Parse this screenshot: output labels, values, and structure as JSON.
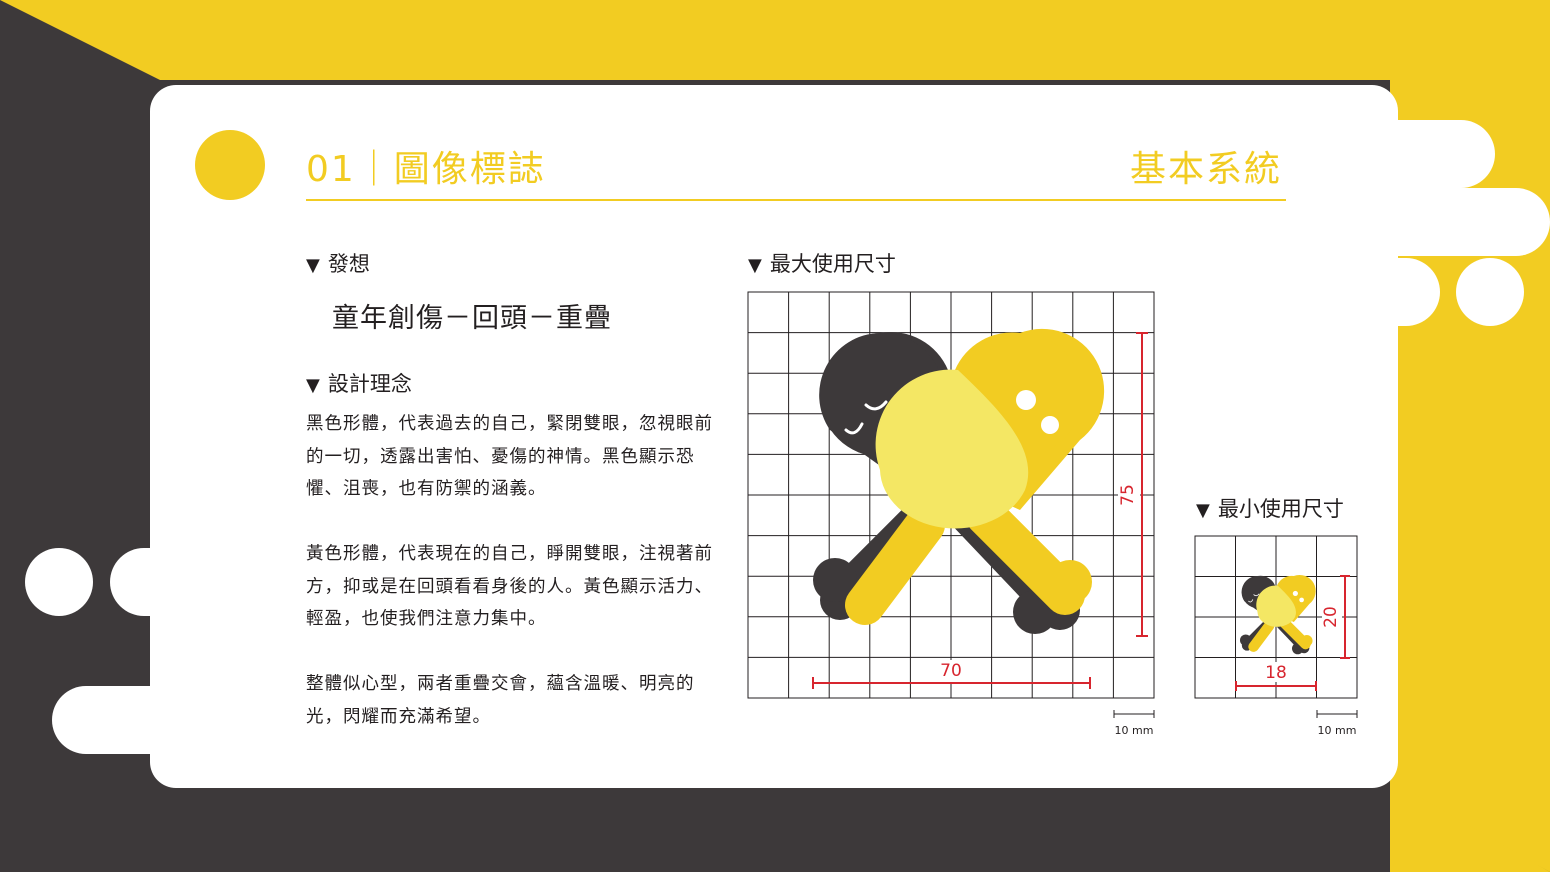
{
  "header": {
    "section_title": "01｜圖像標誌",
    "category": "基本系統"
  },
  "idea": {
    "heading": "發想",
    "concept": "童年創傷－回頭－重疊"
  },
  "design": {
    "heading": "設計理念",
    "paragraphs": [
      "黑色形體，代表過去的自己，緊閉雙眼，忽視眼前的一切，透露出害怕、憂傷的神情。黑色顯示恐懼、沮喪，也有防禦的涵義。",
      "黃色形體，代表現在的自己，睜開雙眼，注視著前方，抑或是在回頭看看身後的人。黃色顯示活力、輕盈，也使我們注意力集中。",
      "整體似心型，兩者重疊交會，蘊含溫暖、明亮的光，閃耀而充滿希望。"
    ]
  },
  "max_size": {
    "heading": "最大使用尺寸",
    "width_mm": "70",
    "height_mm": "75",
    "scale": "10 mm"
  },
  "min_size": {
    "heading": "最小使用尺寸",
    "width_mm": "18",
    "height_mm": "20",
    "scale": "10 mm"
  },
  "colors": {
    "yellow": "#f2cc22",
    "light_yellow": "#f4e764",
    "dark": "#3d393a",
    "dimension_red": "#d7252e"
  },
  "icons": {
    "bullet": "triangle-down-icon",
    "logo": "two-heads-heart-logo"
  }
}
